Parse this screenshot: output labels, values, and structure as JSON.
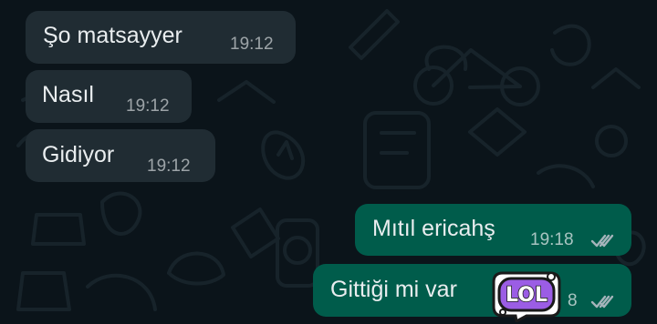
{
  "theme": {
    "background": "#0b141a",
    "incoming_bubble": "#202c33",
    "outgoing_bubble": "#005c4b",
    "text": "#e9edef",
    "tick_color": "#a5b4bb",
    "sticker_fill": "#9b5de5"
  },
  "messages": [
    {
      "direction": "incoming",
      "text": "Şo matsayyer",
      "time": "19:12"
    },
    {
      "direction": "incoming",
      "text": "Nasıl",
      "time": "19:12"
    },
    {
      "direction": "incoming",
      "text": "Gidiyor",
      "time": "19:12"
    },
    {
      "direction": "outgoing",
      "text": "Mıtıl ericahş",
      "time": "19:18",
      "status_icon": "double-check-icon"
    },
    {
      "direction": "outgoing",
      "text": "Gittiği mi var",
      "time": "8",
      "status_icon": "double-check-icon"
    }
  ],
  "sticker": {
    "text": "LOL",
    "icon": "lol-sticker-icon"
  }
}
